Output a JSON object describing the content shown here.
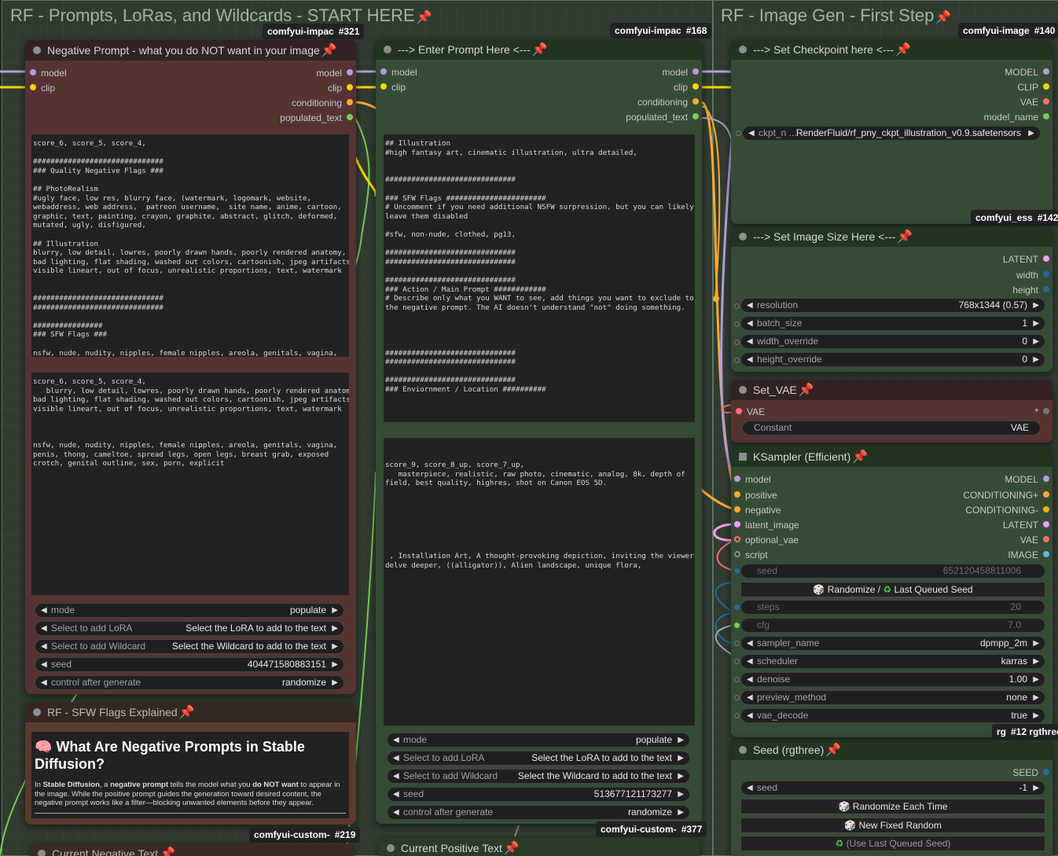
{
  "groups": {
    "prompts": {
      "title": "RF - Prompts, LoRas, and Wildcards - START HERE"
    },
    "imagegen": {
      "title": "RF - Image Gen - First Step"
    }
  },
  "badges": {
    "b321": {
      "label": "comfyui-impac",
      "num": "#321"
    },
    "b168": {
      "label": "comfyui-impac",
      "num": "#168"
    },
    "b140": {
      "label": "comfyui-image",
      "num": "#140"
    },
    "b142": {
      "label": "comfyui_ess",
      "num": "#142"
    },
    "b219": {
      "label": "comfyui-custom-",
      "num": "#219"
    },
    "b377": {
      "label": "comfyui-custom-",
      "num": "#377"
    },
    "b12": {
      "label": "rg",
      "num": "#12 rgthree"
    }
  },
  "neg_node": {
    "title": "Negative Prompt - what you do NOT want in your image",
    "inputs": [
      "model",
      "clip"
    ],
    "outputs": [
      "model",
      "clip",
      "conditioning",
      "populated_text"
    ],
    "text1": "score_6, score_5, score_4,\n\n##############################\n### Quality Negative Flags ###\n\n## PhotoRealism\n#ugly face, low res, blurry face, (watermark, logomark, website,\nwebaddress, web address,  patreon username,  site name, anime, cartoon,\ngraphic, text, painting, crayon, graphite, abstract, glitch, deformed,\nmutated, ugly, disfigured,\n\n## Illustration\nblurry, low detail, lowres, poorly drawn hands, poorly rendered anatomy,\nbad lighting, flat shading, washed out colors, cartoonish, jpeg artifacts,\nvisible lineart, out of focus, unrealistic proportions, text, watermark\n\n\n##############################\n##############################\n\n################\n### SFW Flags ###\n\nnsfw, nude, nudity, nipples, female nipples, areola, genitals, vagina,\npenis, thong, cameltoe, spread legs, open legs, breast grab, exposed",
    "text2": "score_6, score_5, score_4,\n   blurry, low detail, lowres, poorly drawn hands, poorly rendered anatomy,\nbad lighting, flat shading, washed out colors, cartoonish, jpeg artifacts,\nvisible lineart, out of focus, unrealistic proportions, text, watermark\n\n\n\nnsfw, nude, nudity, nipples, female nipples, areola, genitals, vagina,\npenis, thong, cameltoe, spread legs, open legs, breast grab, exposed\ncrotch, genital outline, sex, porn, explicit",
    "widgets": {
      "mode": {
        "label": "mode",
        "value": "populate"
      },
      "lora": {
        "label": "Select to add LoRA",
        "value": "Select the LoRA to add to the text"
      },
      "wildcard": {
        "label": "Select to add Wildcard",
        "value": "Select the Wildcard to add to the text"
      },
      "seed": {
        "label": "seed",
        "value": "404471580883151"
      },
      "control": {
        "label": "control after generate",
        "value": "randomize"
      }
    }
  },
  "pos_node": {
    "title": "---> Enter Prompt Here <---",
    "inputs": [
      "model",
      "clip"
    ],
    "outputs": [
      "model",
      "clip",
      "conditioning",
      "populated_text"
    ],
    "text1": "## Illustration\n#high fantasy art, cinematic illustration, ultra detailed,\n\n\n##############################\n\n### SFW Flags #######################\n# Uncomment if you need additional NSFW surpression, but you can likely\nleave them disabled\n\n#sfw, non-nude, clothed, pg13,\n\n##############################\n##############################\n\n##############################\n### Action / Main Prompt ############\n# Describe only what you WANT to see, add things you want to exclude to\nthe negative prompt. The AI doesn't understand \"not\" doing something.\n\n\n\n\n##############################\n##############################\n\n##############################\n### Enviornment / Location ##########",
    "text2": "\n\nscore_9, score_8_up, score_7_up,\n   masterpiece, realistic, raw photo, cinematic, analog, 8k, depth of\nfield, best quality, highres, shot on Canon EOS 5D.\n\n\n\n\n\n\n\n , Installation Art, A thought-provoking depiction, inviting the viewer to\ndelve deeper, ((alligator)), Alien landscape, unique flora,",
    "widgets": {
      "mode": {
        "label": "mode",
        "value": "populate"
      },
      "lora": {
        "label": "Select to add LoRA",
        "value": "Select the LoRA to add to the text"
      },
      "wildcard": {
        "label": "Select to add Wildcard",
        "value": "Select the Wildcard to add to the text"
      },
      "seed": {
        "label": "seed",
        "value": "513677121173277"
      },
      "control": {
        "label": "control after generate",
        "value": "randomize"
      }
    }
  },
  "sfw_node": {
    "title": "RF - SFW Flags Explained",
    "heading": "What Are Negative Prompts in Stable Diffusion?",
    "body_parts": [
      "In ",
      "Stable Diffusion",
      ", a ",
      "negative prompt",
      " tells the model what you ",
      "do NOT want",
      " to appear in the image. While the positive prompt guides the generation toward desired content, the negative prompt works like a filter—blocking unwanted elements before they appear."
    ]
  },
  "cur_neg": {
    "title": "Current Negative Text"
  },
  "cur_pos": {
    "title": "Current Positive Text"
  },
  "ckpt_node": {
    "title": "---> Set Checkpoint here <---",
    "outputs": [
      "MODEL",
      "CLIP",
      "VAE",
      "model_name"
    ],
    "widget_label": "ckpt_n ...",
    "widget_value": "RenderFluid/rf_pny_ckpt_illustration_v0.9.safetensors"
  },
  "size_node": {
    "title": "---> Set Image Size Here <---",
    "outputs": [
      "LATENT",
      "width",
      "height"
    ],
    "widgets": {
      "resolution": {
        "label": "resolution",
        "value": "768x1344 (0.57)"
      },
      "batch": {
        "label": "batch_size",
        "value": "1"
      },
      "wo": {
        "label": "width_override",
        "value": "0"
      },
      "ho": {
        "label": "height_override",
        "value": "0"
      }
    }
  },
  "vae_node": {
    "title": "Set_VAE",
    "input": "VAE",
    "out_label": "*",
    "const_label": "Constant",
    "const_value": "VAE"
  },
  "ks_node": {
    "title": "KSampler (Efficient)",
    "inputs": [
      "model",
      "positive",
      "negative",
      "latent_image",
      "optional_vae",
      "script"
    ],
    "outputs": [
      "MODEL",
      "CONDITIONING+",
      "CONDITIONING-",
      "LATENT",
      "VAE",
      "IMAGE"
    ],
    "seed": {
      "label": "seed",
      "value": "652120458811006"
    },
    "rand_btn": "Randomize / ",
    "last_btn": "Last Queued Seed",
    "steps": {
      "label": "steps",
      "value": "20"
    },
    "cfg": {
      "label": "cfg",
      "value": "7.0"
    },
    "sampler": {
      "label": "sampler_name",
      "value": "dpmpp_2m"
    },
    "scheduler": {
      "label": "scheduler",
      "value": "karras"
    },
    "denoise": {
      "label": "denoise",
      "value": "1.00"
    },
    "preview": {
      "label": "preview_method",
      "value": "none"
    },
    "vae_decode": {
      "label": "vae_decode",
      "value": "true"
    }
  },
  "seed_node": {
    "title": "Seed (rgthree)",
    "output": "SEED",
    "seed": {
      "label": "seed",
      "value": "-1"
    },
    "btn1": "Randomize Each Time",
    "btn2": "New Fixed Random",
    "btn3": "(Use Last Queued Seed)"
  },
  "colors": {
    "model": "#b39ddb",
    "clip": "#ffd500",
    "conditioning": "#ffa931",
    "string": "#77cc55",
    "latent": "#ff9cf9",
    "vae": "#ff6e6e",
    "int": "#29699c",
    "float": "#a8a8a8"
  }
}
